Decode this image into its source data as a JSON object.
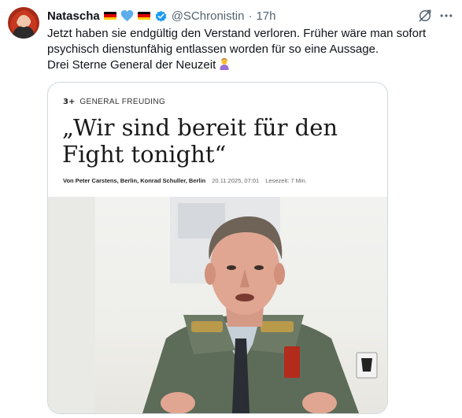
{
  "tweet": {
    "author_name": "Natascha",
    "handle": "@SChronistin",
    "separator": "·",
    "time": "17h",
    "text_lines": [
      "Jetzt haben sie endgültig den Verstand verloren. Früher wäre man sofort",
      "psychisch dienstunfähig entlassen worden für so eine Aussage.",
      "Drei Sterne General der Neuzeit"
    ]
  },
  "card": {
    "publication_badge": "3+",
    "kicker": "GENERAL FREUDING",
    "headline": "„Wir sind bereit für den Fight tonight“",
    "byline_authors": "Von Peter Carstens, Berlin, Konrad Schuller, Berlin",
    "byline_date": "20.11.2025, 07:01",
    "byline_reading": "Lesezeit: 7 Min."
  },
  "colors": {
    "text_primary": "#0f1419",
    "text_secondary": "#536471",
    "verified_blue": "#1d9bf0",
    "card_border": "#cfd9de"
  },
  "icons": {
    "flag": "germany-flag-icon",
    "heart": "blue-heart-icon",
    "verified": "verified-badge-icon",
    "grok": "grok-icon",
    "more": "more-icon",
    "emoji": "woman-facepalming-emoji"
  }
}
